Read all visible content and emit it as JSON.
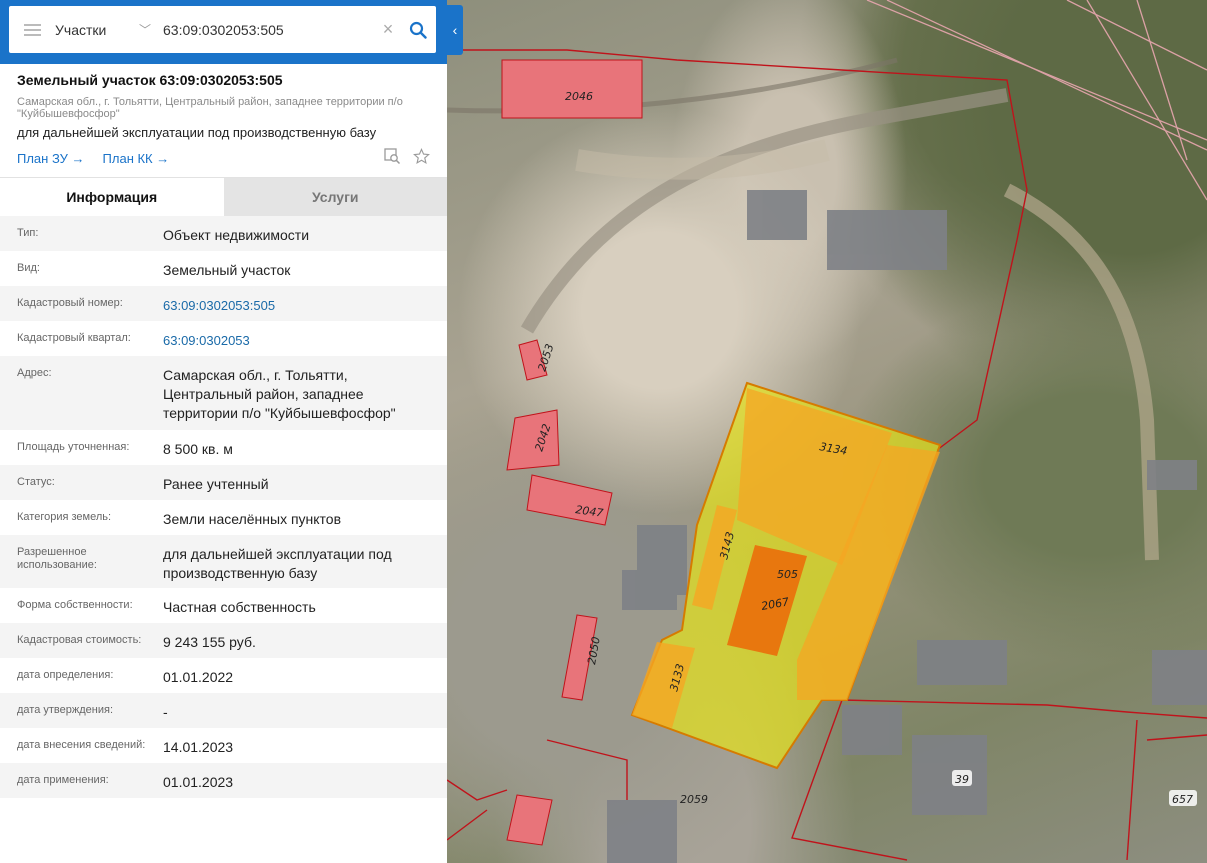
{
  "search": {
    "layer": "Участки",
    "query": "63:09:0302053:505"
  },
  "object": {
    "title": "Земельный участок 63:09:0302053:505",
    "address": "Самарская обл., г. Тольятти, Центральный район, западнее территории п/о \"Куйбышевфосфор\"",
    "use": "для дальнейшей эксплуатации под производственную базу",
    "links": [
      "План ЗУ →",
      "План КК →"
    ]
  },
  "tabs": [
    "Информация",
    "Услуги"
  ],
  "info": [
    {
      "label": "Тип:",
      "value": "Объект недвижимости"
    },
    {
      "label": "Вид:",
      "value": "Земельный участок"
    },
    {
      "label": "Кадастровый номер:",
      "value": "63:09:0302053:505"
    },
    {
      "label": "Кадастровый квартал:",
      "value": "63:09:0302053"
    },
    {
      "label": "Адрес:",
      "value": "Самарская обл., г. Тольятти, Центральный район, западнее территории п/о \"Куйбышевфосфор\""
    },
    {
      "label": "Площадь уточненная:",
      "value": "8 500 кв. м"
    },
    {
      "label": "Статус:",
      "value": "Ранее учтенный"
    },
    {
      "label": "Категория земель:",
      "value": "Земли населённых пунктов"
    },
    {
      "label": "Разрешенное использование:",
      "value": "для дальнейшей эксплуатации под производственную базу"
    },
    {
      "label": "Форма собственности:",
      "value": "Частная собственность"
    },
    {
      "label": "Кадастровая стоимость:",
      "value": "9 243 155 руб."
    },
    {
      "label": "дата определения:",
      "value": "01.01.2022"
    },
    {
      "label": "дата утверждения:",
      "value": "-"
    },
    {
      "label": "дата внесения сведений:",
      "value": "14.01.2023"
    },
    {
      "label": "дата применения:",
      "value": "01.01.2023"
    }
  ],
  "map": {
    "labels": [
      "2046",
      "2053",
      "2042",
      "2047",
      "2050",
      "3134",
      "3143",
      "505",
      "2067",
      "3133",
      "2059",
      "39",
      "657"
    ]
  },
  "colors": {
    "accent": "#1a73c9",
    "parcel_fill": "#e6e21a",
    "building_fill": "#f5a623",
    "selected_building": "#e8770e",
    "red_building": "#e8747a",
    "boundary": "#c0131b"
  }
}
